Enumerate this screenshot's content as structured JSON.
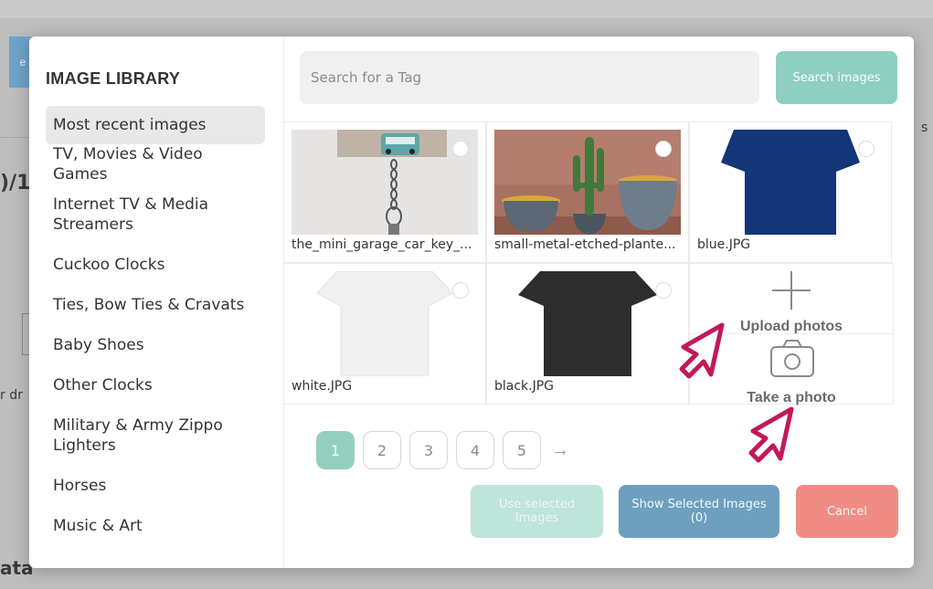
{
  "background": {
    "button_label": "e",
    "text_left": ")/1",
    "text_bottom": "ata",
    "text_mid": "r dr",
    "text_right": "s"
  },
  "library": {
    "title": "IMAGE LIBRARY",
    "categories": [
      {
        "label": "Most recent images",
        "active": true
      },
      {
        "label": "TV, Movies & Video Games"
      },
      {
        "label": "Internet TV & Media Streamers"
      },
      {
        "label": "Cuckoo Clocks"
      },
      {
        "label": "Ties, Bow Ties & Cravats"
      },
      {
        "label": "Baby Shoes"
      },
      {
        "label": "Other Clocks"
      },
      {
        "label": "Military & Army Zippo Lighters"
      },
      {
        "label": "Horses"
      },
      {
        "label": "Music & Art"
      }
    ]
  },
  "search": {
    "placeholder": "Search for a Tag",
    "button_label": "Search images"
  },
  "images": [
    {
      "filename": "the_mini_garage_car_key_...",
      "icon": "car-key-holder-image"
    },
    {
      "filename": "small-metal-etched-plante...",
      "icon": "cactus-planters-image"
    },
    {
      "filename": "blue.JPG",
      "icon": "blue-tshirt-image",
      "color": "#13357a"
    },
    {
      "filename": "white.JPG",
      "icon": "white-tshirt-image",
      "color": "#f3f3f3"
    },
    {
      "filename": "black.JPG",
      "icon": "black-tshirt-image",
      "color": "#2d2d2d"
    }
  ],
  "actions": {
    "upload_label": "Upload photos",
    "take_label": "Take a photo"
  },
  "pagination": {
    "pages": [
      "1",
      "2",
      "3",
      "4",
      "5"
    ],
    "current": "1",
    "next": "→"
  },
  "footer": {
    "use_label": "Use selected Images",
    "show_label": "Show Selected Images (0)",
    "cancel_label": "Cancel"
  },
  "colors": {
    "accent_green": "#8fcfbf",
    "show_blue": "#6d9fbf",
    "cancel_red": "#ef8c86",
    "cursor_pink": "#c2185b"
  }
}
